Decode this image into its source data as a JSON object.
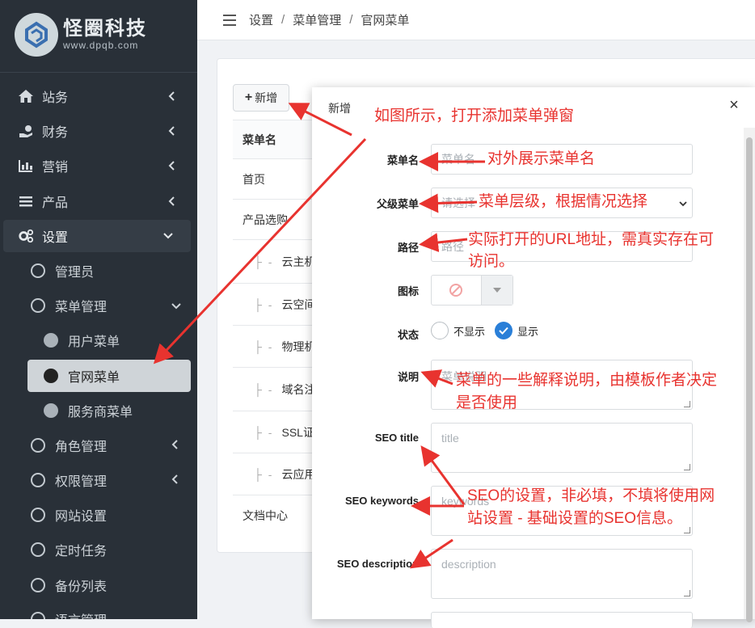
{
  "brand": {
    "name": "怪圈科技",
    "url": "www.dpqb.com"
  },
  "sidebar": {
    "items": [
      {
        "label": "站务",
        "icon": "home-icon"
      },
      {
        "label": "财务",
        "icon": "finance-icon"
      },
      {
        "label": "营销",
        "icon": "chart-icon"
      },
      {
        "label": "产品",
        "icon": "list-icon"
      },
      {
        "label": "设置",
        "icon": "gears-icon"
      }
    ],
    "settings_sub": [
      "管理员",
      "菜单管理"
    ],
    "menu_sub": [
      "用户菜单",
      "官网菜单",
      "服务商菜单"
    ],
    "more_sub": [
      "角色管理",
      "权限管理",
      "网站设置",
      "定时任务",
      "备份列表",
      "语言管理"
    ]
  },
  "breadcrumb": [
    "设置",
    "菜单管理",
    "官网菜单"
  ],
  "toolbar": {
    "add_label": "新增"
  },
  "table": {
    "header": "菜单名",
    "rows": [
      "首页",
      "产品选购",
      "云主机",
      "云空间",
      "物理机",
      "域名注",
      "SSL证书",
      "云应用",
      "文档中心"
    ]
  },
  "modal": {
    "title": "新增",
    "fields": {
      "name_label": "菜单名",
      "name_placeholder": "菜单名",
      "parent_label": "父级菜单",
      "parent_value": "请选择",
      "path_label": "路径",
      "path_placeholder": "路径",
      "icon_label": "图标",
      "status_label": "状态",
      "status_hide": "不显示",
      "status_show": "显示",
      "desc_label": "说明",
      "desc_placeholder": "菜单说明",
      "seo_title_label": "SEO title",
      "seo_title_placeholder": "title",
      "seo_keywords_label": "SEO keywords",
      "seo_keywords_placeholder": "keywords",
      "seo_desc_label": "SEO description",
      "seo_desc_placeholder": "description"
    }
  },
  "annotations": {
    "open_dialog": "如图所示，打开添加菜单弹窗",
    "name": "对外展示菜单名",
    "parent": "菜单层级，根据情况选择",
    "path_1": "实际打开的URL地址，需真实存在可",
    "path_2": "访问。",
    "desc_1": "菜单的一些解释说明，由模板作者决定",
    "desc_2": "是否使用",
    "seo_1": "SEO的设置，非必填，不填将使用网",
    "seo_2": "站设置 - 基础设置的SEO信息。"
  },
  "colors": {
    "sidebar_bg": "#293038",
    "accent": "#2a7fd8",
    "annotation": "#e8332f"
  }
}
